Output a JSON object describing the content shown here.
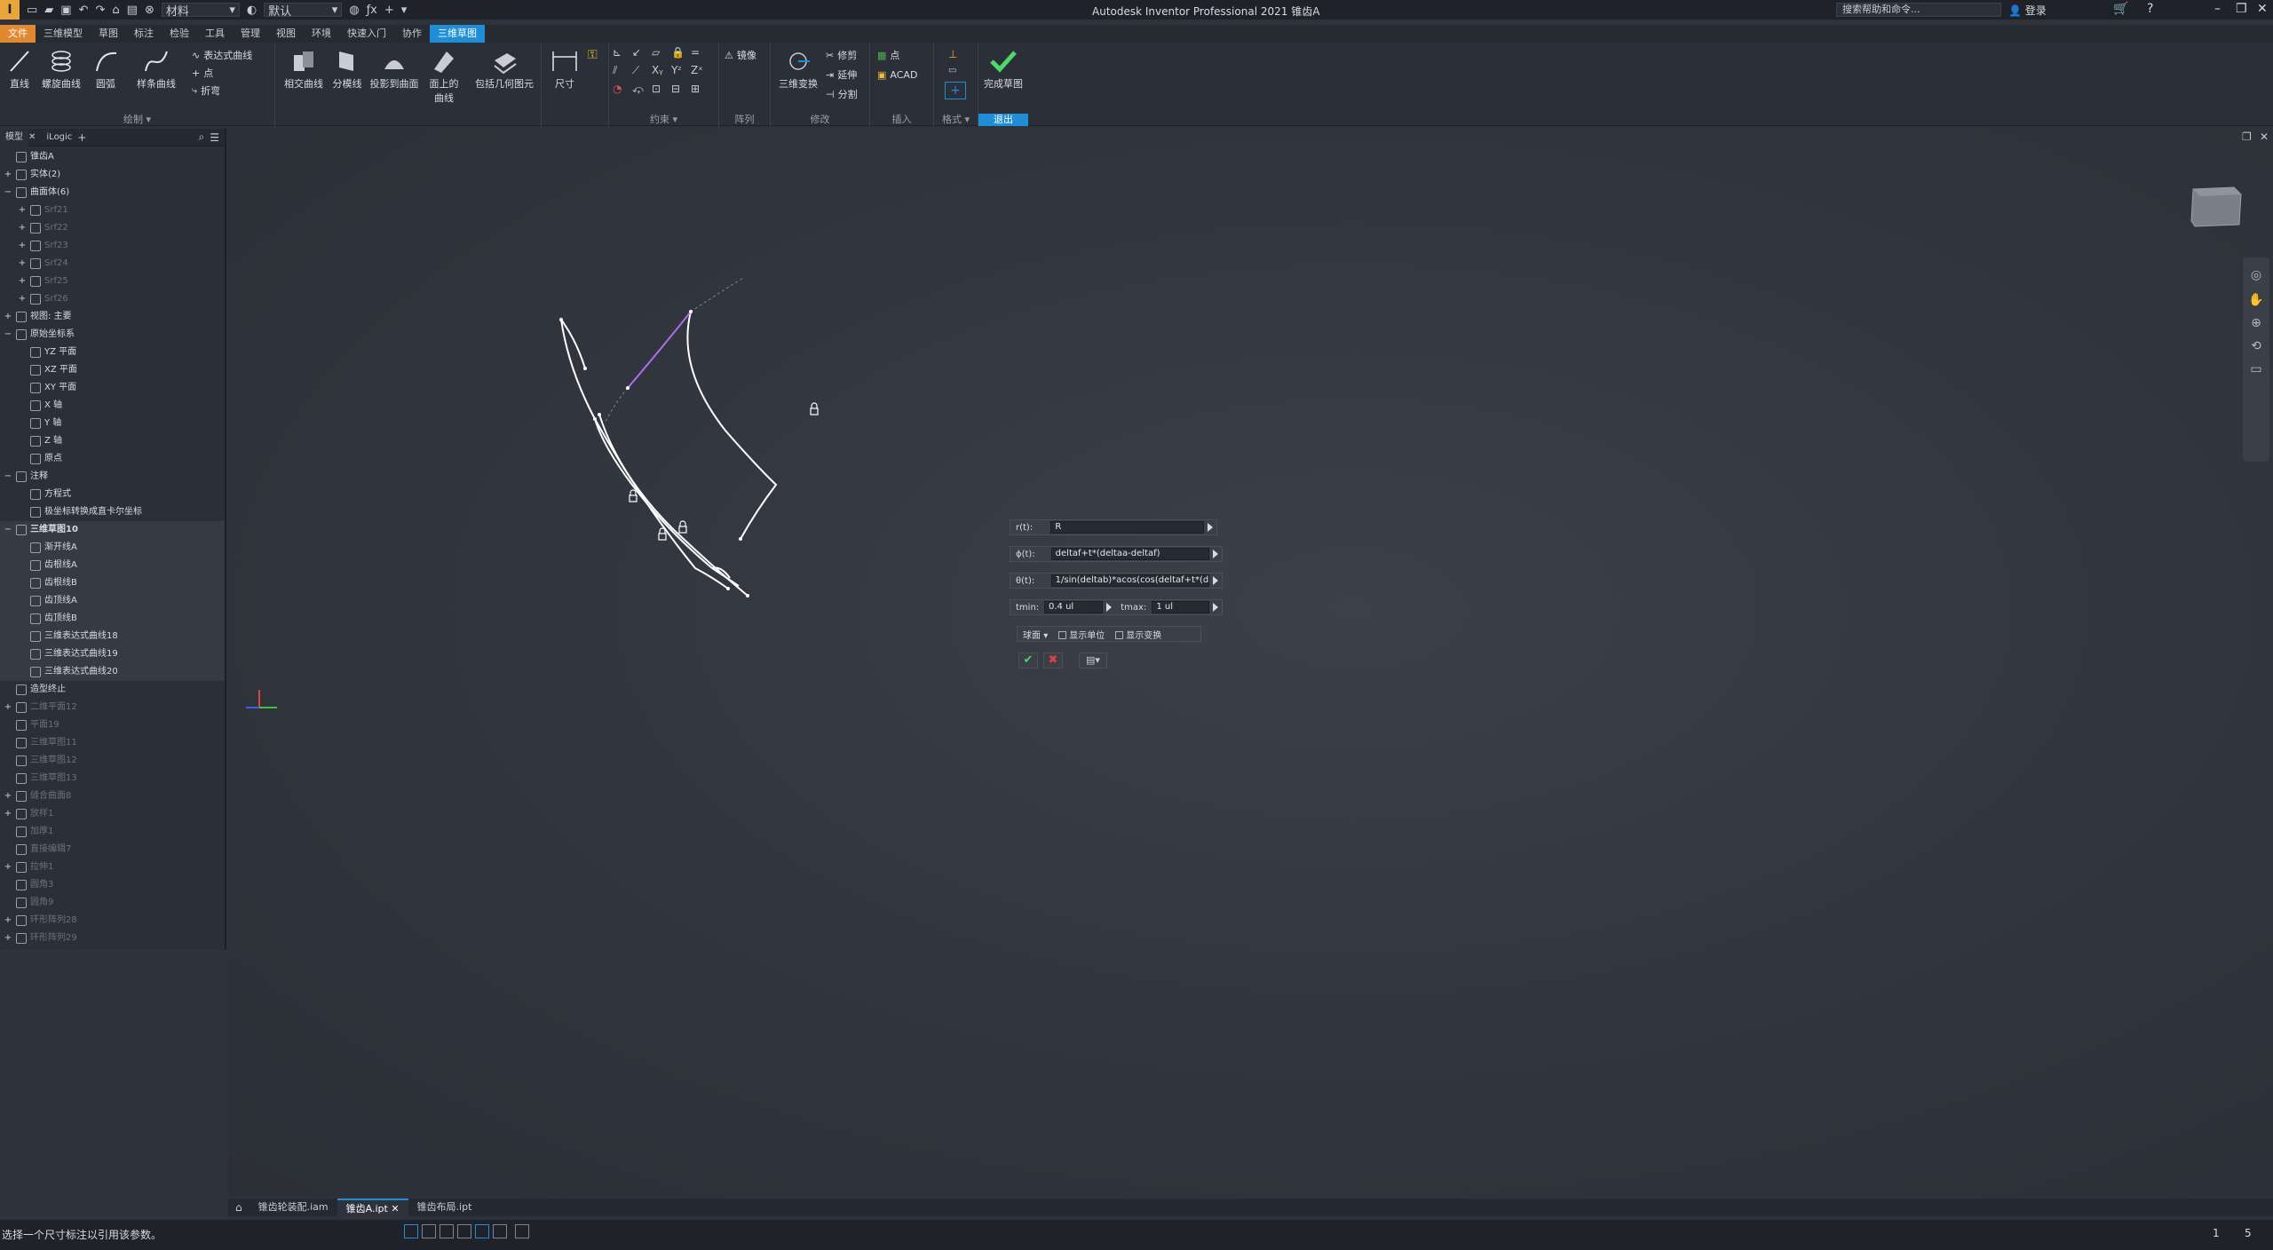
{
  "app": {
    "title": "Autodesk Inventor Professional 2021    锥齿A",
    "logo": "I",
    "help_search_placeholder": "搜索帮助和命令...",
    "login": "登录",
    "appearance_combo": "默认",
    "material_combo": "材料"
  },
  "ribbon_tabs": [
    {
      "label": "文件",
      "kind": "file"
    },
    {
      "label": "三维模型",
      "kind": ""
    },
    {
      "label": "草图",
      "kind": ""
    },
    {
      "label": "标注",
      "kind": ""
    },
    {
      "label": "检验",
      "kind": ""
    },
    {
      "label": "工具",
      "kind": ""
    },
    {
      "label": "管理",
      "kind": ""
    },
    {
      "label": "视图",
      "kind": ""
    },
    {
      "label": "环境",
      "kind": ""
    },
    {
      "label": "快速入门",
      "kind": ""
    },
    {
      "label": "协作",
      "kind": ""
    },
    {
      "label": "三维草图",
      "kind": "active"
    }
  ],
  "ribbon": {
    "draw": {
      "label": "绘制 ▾",
      "line": "直线",
      "helix": "螺旋曲线",
      "arc": "圆弧",
      "spline": "样条曲线",
      "equation_curve": "表达式曲线",
      "point": "点",
      "bend": "折弯",
      "intersection_curve": "相交曲线",
      "silhouette_curve": "分模线",
      "project_to_surface": "投影到曲面",
      "curve_on_face": "面上的",
      "curve_on_face_2": "曲线",
      "include_geometry": "包括几何图元"
    },
    "dimension": "尺寸",
    "constrain": {
      "label": "约束 ▾"
    },
    "pattern": {
      "label": "阵列",
      "mirror": "镜像"
    },
    "modify": {
      "label": "修改",
      "transform": "三维变换",
      "trim": "修剪",
      "extend": "延伸",
      "split": "分割"
    },
    "insert": {
      "label": "插入",
      "point": "点",
      "acad": "ACAD"
    },
    "format": {
      "label": "格式 ▾"
    },
    "exit": {
      "label": "退出",
      "finish": "完成草图"
    }
  },
  "browser": {
    "tabs": [
      "模型",
      "iLogic"
    ],
    "items": [
      {
        "label": "锥齿A",
        "level": 0,
        "exp": "",
        "dim": false,
        "shade": false,
        "bold": false
      },
      {
        "label": "实体(2)",
        "level": 0,
        "exp": "+",
        "dim": false,
        "shade": false,
        "bold": false
      },
      {
        "label": "曲面体(6)",
        "level": 0,
        "exp": "−",
        "dim": false,
        "shade": false,
        "bold": false
      },
      {
        "label": "Srf21",
        "level": 1,
        "exp": "+",
        "dim": true,
        "shade": false,
        "bold": false
      },
      {
        "label": "Srf22",
        "level": 1,
        "exp": "+",
        "dim": true,
        "shade": false,
        "bold": false
      },
      {
        "label": "Srf23",
        "level": 1,
        "exp": "+",
        "dim": true,
        "shade": false,
        "bold": false
      },
      {
        "label": "Srf24",
        "level": 1,
        "exp": "+",
        "dim": true,
        "shade": false,
        "bold": false
      },
      {
        "label": "Srf25",
        "level": 1,
        "exp": "+",
        "dim": true,
        "shade": false,
        "bold": false
      },
      {
        "label": "Srf26",
        "level": 1,
        "exp": "+",
        "dim": true,
        "shade": false,
        "bold": false
      },
      {
        "label": "视图: 主要",
        "level": 0,
        "exp": "+",
        "dim": false,
        "shade": false,
        "bold": false
      },
      {
        "label": "原始坐标系",
        "level": 0,
        "exp": "−",
        "dim": false,
        "shade": false,
        "bold": false
      },
      {
        "label": "YZ 平面",
        "level": 1,
        "exp": "",
        "dim": false,
        "shade": false,
        "bold": false
      },
      {
        "label": "XZ 平面",
        "level": 1,
        "exp": "",
        "dim": false,
        "shade": false,
        "bold": false
      },
      {
        "label": "XY 平面",
        "level": 1,
        "exp": "",
        "dim": false,
        "shade": false,
        "bold": false
      },
      {
        "label": "X 轴",
        "level": 1,
        "exp": "",
        "dim": false,
        "shade": false,
        "bold": false
      },
      {
        "label": "Y 轴",
        "level": 1,
        "exp": "",
        "dim": false,
        "shade": false,
        "bold": false
      },
      {
        "label": "Z 轴",
        "level": 1,
        "exp": "",
        "dim": false,
        "shade": false,
        "bold": false
      },
      {
        "label": "原点",
        "level": 1,
        "exp": "",
        "dim": false,
        "shade": false,
        "bold": false
      },
      {
        "label": "注释",
        "level": 0,
        "exp": "−",
        "dim": false,
        "shade": false,
        "bold": false
      },
      {
        "label": "方程式",
        "level": 1,
        "exp": "",
        "dim": false,
        "shade": false,
        "bold": false
      },
      {
        "label": "极坐标转换成直卡尔坐标",
        "level": 1,
        "exp": "",
        "dim": false,
        "shade": false,
        "bold": false
      },
      {
        "label": "三维草图10",
        "level": 0,
        "exp": "−",
        "dim": false,
        "shade": true,
        "bold": true
      },
      {
        "label": "渐开线A",
        "level": 1,
        "exp": "",
        "dim": false,
        "shade": true,
        "bold": false
      },
      {
        "label": "齿根线A",
        "level": 1,
        "exp": "",
        "dim": false,
        "shade": true,
        "bold": false
      },
      {
        "label": "齿根线B",
        "level": 1,
        "exp": "",
        "dim": false,
        "shade": true,
        "bold": false
      },
      {
        "label": "齿顶线A",
        "level": 1,
        "exp": "",
        "dim": false,
        "shade": true,
        "bold": false
      },
      {
        "label": "齿顶线B",
        "level": 1,
        "exp": "",
        "dim": false,
        "shade": true,
        "bold": false
      },
      {
        "label": "三维表达式曲线18",
        "level": 1,
        "exp": "",
        "dim": false,
        "shade": true,
        "bold": false
      },
      {
        "label": "三维表达式曲线19",
        "level": 1,
        "exp": "",
        "dim": false,
        "shade": true,
        "bold": false
      },
      {
        "label": "三维表达式曲线20",
        "level": 1,
        "exp": "",
        "dim": false,
        "shade": true,
        "bold": false
      },
      {
        "label": "造型终止",
        "level": 0,
        "exp": "",
        "dim": false,
        "shade": false,
        "bold": false
      },
      {
        "label": "二维平面12",
        "level": 0,
        "exp": "+",
        "dim": true,
        "shade": false,
        "bold": false
      },
      {
        "label": "平面19",
        "level": 0,
        "exp": "",
        "dim": true,
        "shade": false,
        "bold": false
      },
      {
        "label": "三维草图11",
        "level": 0,
        "exp": "",
        "dim": true,
        "shade": false,
        "bold": false
      },
      {
        "label": "三维草图12",
        "level": 0,
        "exp": "",
        "dim": true,
        "shade": false,
        "bold": false
      },
      {
        "label": "三维草图13",
        "level": 0,
        "exp": "",
        "dim": true,
        "shade": false,
        "bold": false
      },
      {
        "label": "缝合曲面8",
        "level": 0,
        "exp": "+",
        "dim": true,
        "shade": false,
        "bold": false
      },
      {
        "label": "放样1",
        "level": 0,
        "exp": "+",
        "dim": true,
        "shade": false,
        "bold": false
      },
      {
        "label": "加厚1",
        "level": 0,
        "exp": "",
        "dim": true,
        "shade": false,
        "bold": false
      },
      {
        "label": "直接编辑7",
        "level": 0,
        "exp": "",
        "dim": true,
        "shade": false,
        "bold": false
      },
      {
        "label": "拉伸1",
        "level": 0,
        "exp": "+",
        "dim": true,
        "shade": false,
        "bold": false
      },
      {
        "label": "圆角3",
        "level": 0,
        "exp": "",
        "dim": true,
        "shade": false,
        "bold": false
      },
      {
        "label": "圆角9",
        "level": 0,
        "exp": "",
        "dim": true,
        "shade": false,
        "bold": false
      },
      {
        "label": "环形阵列28",
        "level": 0,
        "exp": "+",
        "dim": true,
        "shade": false,
        "bold": false
      },
      {
        "label": "环形阵列29",
        "level": 0,
        "exp": "+",
        "dim": true,
        "shade": false,
        "bold": false
      }
    ]
  },
  "equation_dialog": {
    "r_label": "r(t):",
    "r_value": "R",
    "phi_label": "ϕ(t):",
    "phi_value": "deltaf+t*(deltaa-deltaf)",
    "theta_label": "θ(t):",
    "theta_value": "1/sin(deltab)*acos(cos(deltaf+t*(deltaa-deltaf) )/cos(deltab))",
    "tmin_label": "tmin:",
    "tmin_value": "0.4 ul",
    "tmax_label": "tmax:",
    "tmax_value": "1 ul",
    "coord_system": "球面",
    "show_units": "显示单位",
    "show_transform": "显示变换"
  },
  "doc_tabs": [
    {
      "label": "锥齿轮装配.iam",
      "active": false
    },
    {
      "label": "锥齿A.ipt",
      "active": true
    },
    {
      "label": "锥齿布局.ipt",
      "active": false
    }
  ],
  "status": {
    "message": "选择一个尺寸标注以引用该参数。",
    "num1": "1",
    "num2": "5"
  },
  "colors": {
    "accent": "#1e8fd6",
    "file_tab": "#e1892f",
    "selected_curve": "#b06cf0",
    "sketch_curve": "#ffffff"
  }
}
